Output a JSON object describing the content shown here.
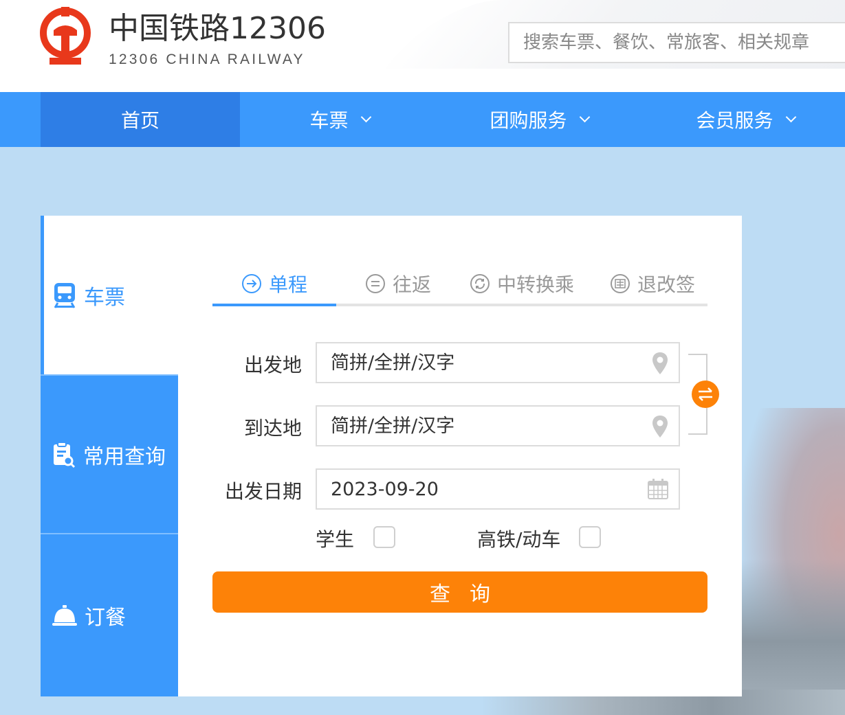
{
  "header": {
    "brand_title": "中国铁路12306",
    "brand_subtitle": "12306 CHINA RAILWAY",
    "search_placeholder": "搜索车票、餐饮、常旅客、相关规章",
    "logo_color": "#e8381b"
  },
  "nav": {
    "items": [
      {
        "label": "首页",
        "active": true
      },
      {
        "label": "车票",
        "has_dropdown": true
      },
      {
        "label": "团购服务",
        "has_dropdown": true
      },
      {
        "label": "会员服务",
        "has_dropdown": true
      }
    ]
  },
  "sidebar": {
    "items": [
      {
        "label": "车票",
        "icon": "train-icon",
        "active": true
      },
      {
        "label": "常用查询",
        "icon": "clipboard-search-icon"
      },
      {
        "label": "订餐",
        "icon": "service-bell-icon"
      }
    ]
  },
  "tabs": [
    {
      "label": "单程",
      "icon": "arrow-circle-icon",
      "active": true
    },
    {
      "label": "往返",
      "icon": "equals-circle-icon"
    },
    {
      "label": "中转换乘",
      "icon": "refresh-circle-icon"
    },
    {
      "label": "退改签",
      "icon": "ticket-circle-icon"
    }
  ],
  "form": {
    "from_label": "出发地",
    "from_placeholder": "简拼/全拼/汉字",
    "to_label": "到达地",
    "to_placeholder": "简拼/全拼/汉字",
    "date_label": "出发日期",
    "date_value": "2023-09-20",
    "student_label": "学生",
    "highspeed_label": "高铁/动车",
    "query_label": "查询"
  },
  "colors": {
    "primary": "#3b99fc",
    "primary_dark": "#2e7ee6",
    "accent": "#fd8208"
  }
}
